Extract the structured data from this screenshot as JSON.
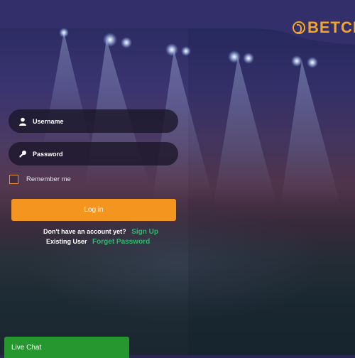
{
  "brand": {
    "logo_text": "BETCI",
    "accent_color": "#f5a623",
    "header_color": "#332f6b"
  },
  "login": {
    "username_placeholder": "Username",
    "password_placeholder": "Password",
    "remember_label": "Remember me",
    "login_button": "Log in",
    "login_button_color": "#f3951f",
    "no_account_text": "Don't have an account yet?",
    "signup_link": "Sign Up",
    "existing_user_text": "Existing User",
    "forget_password_link": "Forget Password",
    "link_color": "#2fb86d"
  },
  "livechat": {
    "label": "Live Chat",
    "color": "#26962f"
  },
  "icons": {
    "username": "user-icon",
    "password": "key-icon",
    "logo": "coin-logo-icon"
  }
}
